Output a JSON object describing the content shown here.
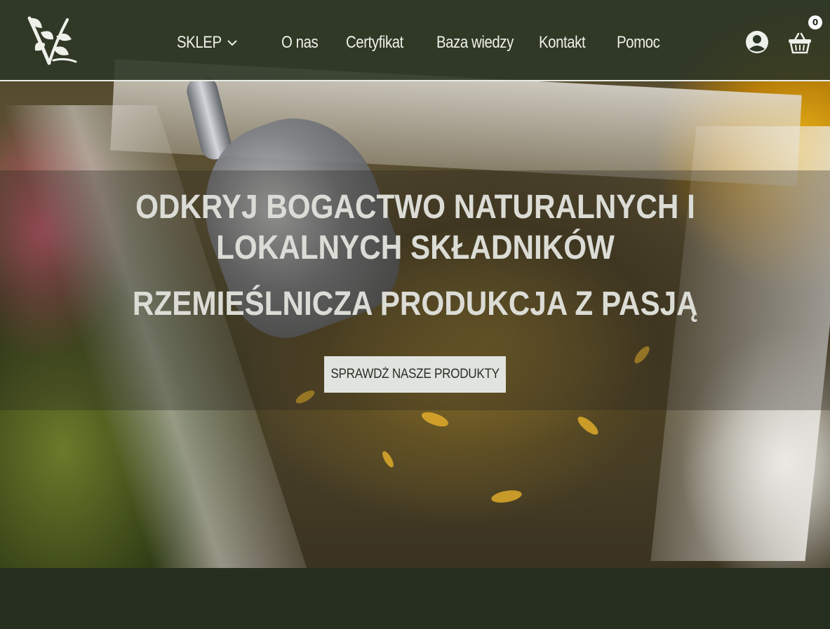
{
  "header": {
    "nav": [
      {
        "label": "SKLEP",
        "has_dropdown": true
      },
      {
        "label": "O nas"
      },
      {
        "label": "Certyfikat"
      },
      {
        "label": "Baza wiedzy"
      },
      {
        "label": "Kontakt"
      },
      {
        "label": "Pomoc"
      }
    ],
    "icons": {
      "logo": "herb-leaf-logo",
      "account": "user-circle-icon",
      "cart": "basket-icon"
    },
    "cart_count": "0"
  },
  "hero": {
    "title": "ODKRYJ BOGACTWO NATURALNYCH I LOKALNYCH SKŁADNIKÓW",
    "subtitle": "RZEMIEŚLNICZA PRODUKCJA Z PASJĄ",
    "cta_label": "SPRAWDŹ NASZE PRODUKTY"
  },
  "colors": {
    "header_bg": "#2c3626",
    "page_bg": "#262e20",
    "text_light": "#eef0ea",
    "cta_bg": "#e1e3df"
  }
}
